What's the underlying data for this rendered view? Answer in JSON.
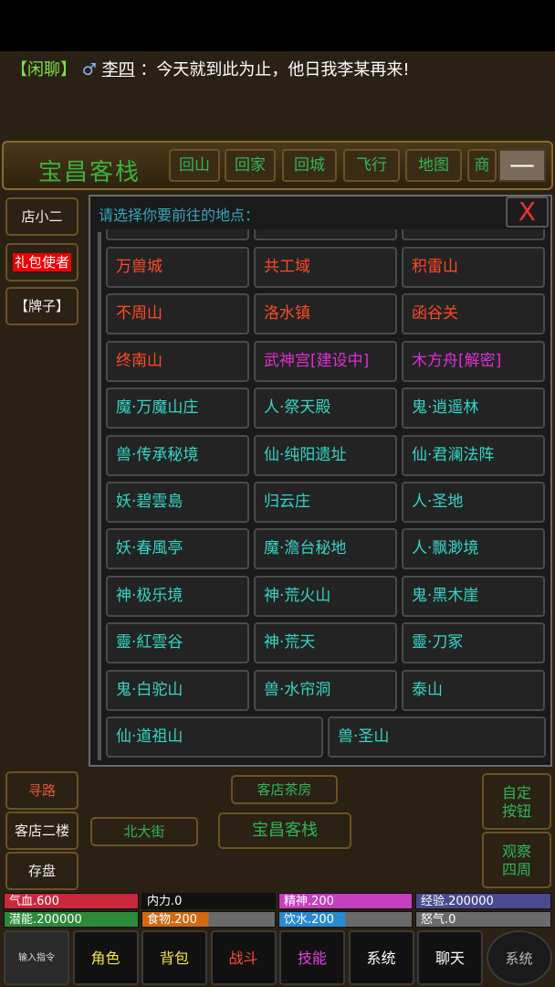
{
  "chat": {
    "tag": "【闲聊】",
    "gender_icon": "♂",
    "speaker": "李四",
    "message": "：今天就到此为止，他日我李某再来!"
  },
  "location_bar": {
    "title": "宝昌客栈",
    "buttons": [
      "回山",
      "回家",
      "回城",
      "飞行",
      "地图",
      "商"
    ],
    "minimize": "—"
  },
  "sidebar_top": [
    "店小二",
    "礼包使者",
    "【牌子】"
  ],
  "dialog": {
    "title": "请选择你要前往的地点：",
    "close": "X",
    "rows": [
      [
        {
          "name": "万兽城",
          "color": "red"
        },
        {
          "name": "共工域",
          "color": "red"
        },
        {
          "name": "积雷山",
          "color": "red"
        }
      ],
      [
        {
          "name": "不周山",
          "color": "red"
        },
        {
          "name": "洛水镇",
          "color": "red"
        },
        {
          "name": "函谷关",
          "color": "red"
        }
      ],
      [
        {
          "name": "终南山",
          "color": "red"
        },
        {
          "name": "武神宫[建设中]",
          "color": "pink"
        },
        {
          "name": "木方舟[解密]",
          "color": "pink"
        }
      ],
      [
        {
          "name": "魔·万魔山庄",
          "color": "cyan"
        },
        {
          "name": "人·祭天殿",
          "color": "cyan"
        },
        {
          "name": "鬼·逍遥林",
          "color": "cyan"
        }
      ],
      [
        {
          "name": "兽·传承秘境",
          "color": "cyan"
        },
        {
          "name": "仙·纯阳遗址",
          "color": "cyan"
        },
        {
          "name": "仙·君澜法阵",
          "color": "cyan"
        }
      ],
      [
        {
          "name": "妖·碧雲島",
          "color": "cyan"
        },
        {
          "name": "归云庄",
          "color": "cyan"
        },
        {
          "name": "人·圣地",
          "color": "cyan"
        }
      ],
      [
        {
          "name": "妖·春風亭",
          "color": "cyan"
        },
        {
          "name": "魔·澹台秘地",
          "color": "cyan"
        },
        {
          "name": "人·飘渺境",
          "color": "cyan"
        }
      ],
      [
        {
          "name": "神·极乐境",
          "color": "cyan"
        },
        {
          "name": "神·荒火山",
          "color": "cyan"
        },
        {
          "name": "鬼·黑木崖",
          "color": "cyan"
        }
      ],
      [
        {
          "name": "靈·紅雲谷",
          "color": "cyan"
        },
        {
          "name": "神·荒天",
          "color": "cyan"
        },
        {
          "name": "靈·刀冢",
          "color": "cyan"
        }
      ],
      [
        {
          "name": "鬼·白驼山",
          "color": "cyan"
        },
        {
          "name": "兽·水帘洞",
          "color": "cyan"
        },
        {
          "name": "泰山",
          "color": "cyan"
        }
      ],
      [
        {
          "name": "仙·道祖山",
          "color": "cyan"
        },
        {
          "name": "兽·圣山",
          "color": "cyan"
        }
      ]
    ]
  },
  "sidebar_bottom": [
    "寻路",
    "客店二楼",
    "存盘"
  ],
  "exits": {
    "north": "客店茶房",
    "west": "北大街",
    "current": "宝昌客栈"
  },
  "right_buttons": {
    "custom": [
      "自定",
      "按钮"
    ],
    "observe": [
      "观察",
      "四周"
    ]
  },
  "stats": [
    {
      "label": "气血.600",
      "color": "#c8283c",
      "fill": 1.0
    },
    {
      "label": "内力.0",
      "color": "#222222",
      "fill": 0.0
    },
    {
      "label": "精神.200",
      "color": "#c53fbf",
      "fill": 1.0
    },
    {
      "label": "经验.200000",
      "color": "#4a4a8e",
      "fill": 1.0
    },
    {
      "label": "潜能.200000",
      "color": "#2d8a3a",
      "fill": 1.0
    },
    {
      "label": "食物.200",
      "color": "#d06a14",
      "fill": 0.5
    },
    {
      "label": "饮水.200",
      "color": "#2a8ad0",
      "fill": 0.5
    },
    {
      "label": "怒气.0",
      "color": "#555555",
      "fill": 0.0
    }
  ],
  "nav": [
    {
      "label": "输入指令",
      "color": "#ddd"
    },
    {
      "label": "角色",
      "color": "#f4e44a"
    },
    {
      "label": "背包",
      "color": "#f4e44a"
    },
    {
      "label": "战斗",
      "color": "#ff4a3a"
    },
    {
      "label": "技能",
      "color": "#ea3ee0"
    },
    {
      "label": "系统",
      "color": "#ffffff"
    },
    {
      "label": "聊天",
      "color": "#ffffff"
    },
    {
      "label": "系统",
      "color": "#bbbbbb"
    }
  ]
}
